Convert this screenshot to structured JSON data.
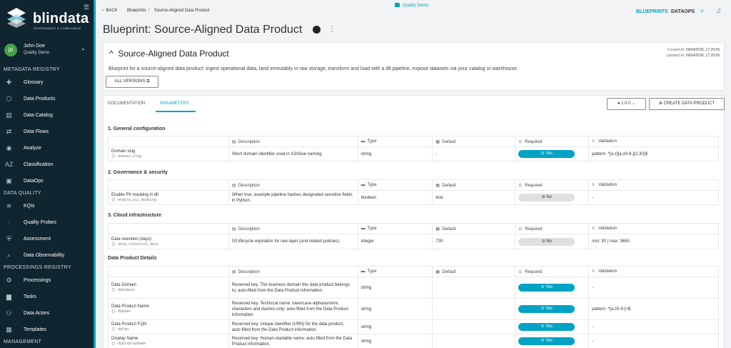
{
  "brand": {
    "name": "blindata",
    "tagline": "GOVERNANCE & COMPLIANCE"
  },
  "user": {
    "initials": "jd",
    "name": "John Doe",
    "tenant": "Quality Demo"
  },
  "sidebar": {
    "sections": [
      "METADATA REGISTRY",
      "DATA QUALITY",
      "PROCESSINGS REGISTRY",
      "MANAGEMENT"
    ],
    "items": [
      {
        "label": "Glossary",
        "icon": "puzzle-icon"
      },
      {
        "label": "Data Products",
        "icon": "hexagon-icon"
      },
      {
        "label": "Data Catalog",
        "icon": "catalog-icon"
      },
      {
        "label": "Data Flows",
        "icon": "flow-icon"
      },
      {
        "label": "Analyze",
        "icon": "compass-icon"
      },
      {
        "label": "Classification",
        "icon": "az-icon"
      },
      {
        "label": "DataOps",
        "icon": "dataops-icon"
      },
      {
        "label": "KQIs",
        "icon": "signal-icon"
      },
      {
        "label": "Quality Probes",
        "icon": "probe-icon"
      },
      {
        "label": "Assessment",
        "icon": "shield-check-icon"
      },
      {
        "label": "Data Observability",
        "icon": "observe-icon"
      },
      {
        "label": "Processings",
        "icon": "processing-icon"
      },
      {
        "label": "Tasks",
        "icon": "briefcase-icon"
      },
      {
        "label": "Data Actors",
        "icon": "people-icon"
      },
      {
        "label": "Templates",
        "icon": "template-icon"
      }
    ]
  },
  "topbar": {
    "back": "BACK",
    "breadcrumb": [
      "Blueprints",
      "Source-Aligned Data Product"
    ],
    "tenant": "Quality Demo",
    "links": [
      "BLUEPRINTS",
      "DATAOPS"
    ]
  },
  "page": {
    "title": "Blueprint: Source-Aligned Data Product"
  },
  "summary": {
    "title": "Source-Aligned Data Product",
    "created_label": "Created At:",
    "created": "09/04/2026, 17:29:09",
    "updated_label": "Updated At:",
    "updated": "09/04/2026, 17:29:09",
    "description": "Blueprint for a source-aligned data product: ingest operational data, land immutably in raw storage, transform and load with a dlt pipeline, expose datasets via your catalog or warehouse.",
    "all_versions": "ALL VERSIONS"
  },
  "tabs": {
    "documentation": "DOCUMENTATION",
    "parameters": "PARAMETERS",
    "version": "1.0.0",
    "create": "CREATE DATA PRODUCT"
  },
  "columns": {
    "description": "Description",
    "type": "Type",
    "default": "Default",
    "required": "Required",
    "validation": "Validation"
  },
  "groups": [
    {
      "title": "1. General configuration",
      "rows": [
        {
          "name": "Domain slug",
          "key": "domain_slug",
          "description": "Short domain identifier used in S3/Glue naming.",
          "type": "string",
          "default": "-",
          "required": "Yes",
          "validation": "pattern: ^[a-z][a-z0-9-]{2,30}$"
        }
      ]
    },
    {
      "title": "2. Governance & security",
      "rows": [
        {
          "name": "Enable PII masking in dlt",
          "key": "enable_pii_masking",
          "description": "When true, example pipeline hashes designated sensitive fields in Python.",
          "type": "boolean",
          "default": "true",
          "required": "No",
          "validation": "-"
        }
      ]
    },
    {
      "title": "3. Cloud infrastructure",
      "rows": [
        {
          "name": "Data retention (days)",
          "key": "data_retention_days",
          "description": "S3 lifecycle expiration for raw layer (and related policies).",
          "type": "integer",
          "default": "730",
          "required": "No",
          "validation": "min: 30 | max: 3650"
        }
      ]
    },
    {
      "title": "Data Product Details",
      "rows": [
        {
          "name": "Data Domain",
          "key": "dpDomain",
          "description": "Reserved key. The business domain this data product belongs to; auto-filled from the Data Product information.",
          "type": "string",
          "default": "",
          "required": "Yes",
          "validation": "-"
        },
        {
          "name": "Data Product Name",
          "key": "dpName",
          "description": "Reserved key. Technical name: lowercase alphanumeric characters and dashes only; auto-filled from the Data Product information.",
          "type": "string",
          "default": "",
          "required": "Yes",
          "validation": "pattern: ^[a-z0-9-]+$"
        },
        {
          "name": "Data Product FQN",
          "key": "dpFqn",
          "description": "Reserved key. Unique identifier (URN) for the data product; auto-filled from the Data Product information.",
          "type": "string",
          "default": "",
          "required": "Yes",
          "validation": "-"
        },
        {
          "name": "Display Name",
          "key": "dpDisplayName",
          "description": "Reserved key. Human-readable name; auto-filled from the Data Product information.",
          "type": "string",
          "default": "",
          "required": "Yes",
          "validation": "-"
        }
      ]
    }
  ],
  "colors": {
    "accent": "#00a3c4",
    "sidebar": "#0f2530",
    "avatar": "#43a047"
  }
}
